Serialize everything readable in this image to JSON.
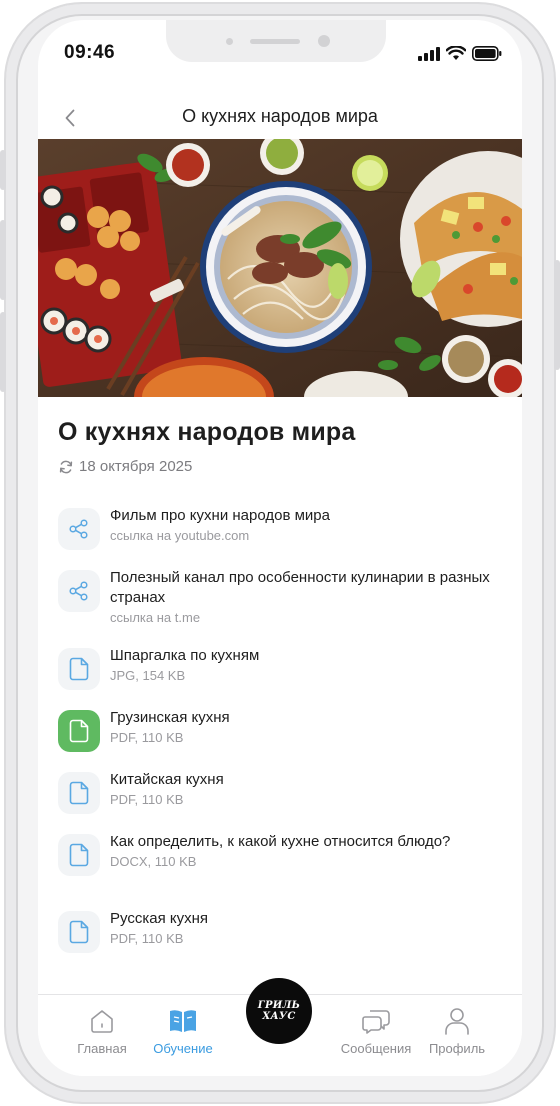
{
  "status": {
    "time": "09:46"
  },
  "header": {
    "title": "О кухнях народов мира"
  },
  "article": {
    "title": "О кухнях народов мира",
    "date": "18 октября 2025"
  },
  "materials": [
    {
      "icon": "share-icon",
      "title": "Фильм про кухни народов мира",
      "meta": "ссылка на youtube.com"
    },
    {
      "icon": "share-icon",
      "title": "Полезный канал про особенности кулинарии в разных странах",
      "meta": "ссылка на t.me"
    },
    {
      "icon": "file-icon",
      "title": "Шпаргалка по кухням",
      "meta": "JPG, 154 KB"
    },
    {
      "icon": "file-icon",
      "title": "Грузинская кухня",
      "meta": "PDF, 110 KB",
      "highlight": true
    },
    {
      "icon": "file-icon",
      "title": "Китайская кухня",
      "meta": "PDF, 110 KB"
    },
    {
      "icon": "file-icon",
      "title": "Как определить, к какой кухне относится блюдо?",
      "meta": "DOCX, 110 KB"
    },
    {
      "icon": "file-icon",
      "title": "Русская кухня",
      "meta": "PDF, 110 KB"
    }
  ],
  "tabbar": {
    "home": "Главная",
    "learning": "Обучение",
    "messages": "Сообщения",
    "profile": "Профиль",
    "logo_line1": "ГРИЛЬ",
    "logo_line2": "ХАУС"
  },
  "colors": {
    "accent": "#3a9be0",
    "highlight_icon_bg": "#5fba61",
    "icon_stroke": "#5aa8e2"
  }
}
